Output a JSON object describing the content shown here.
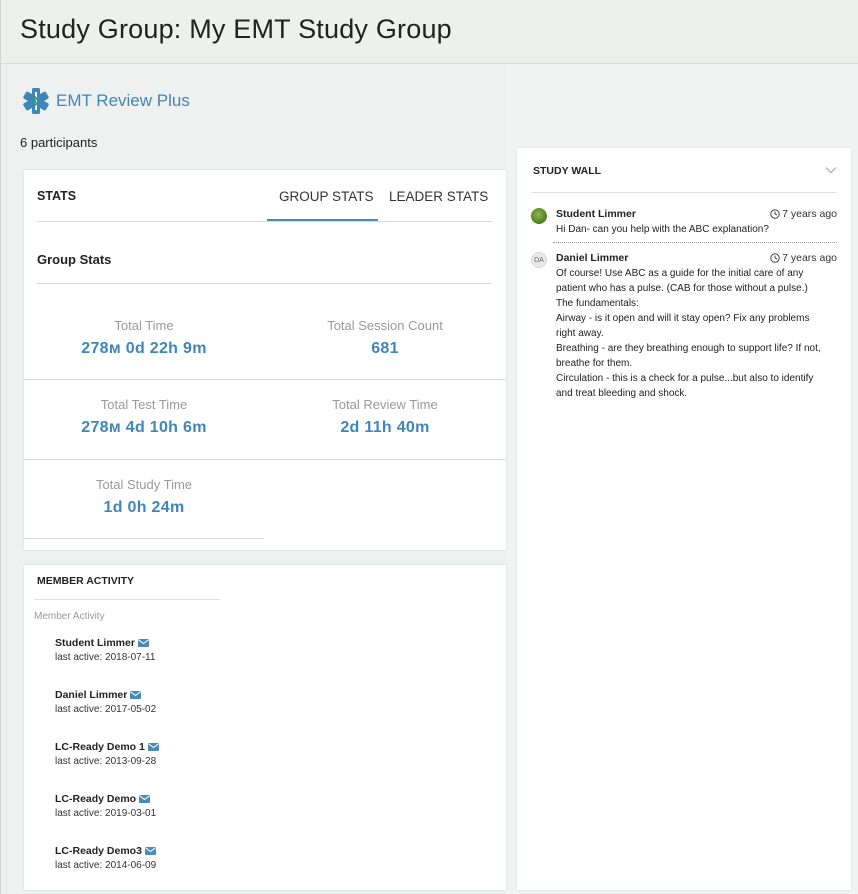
{
  "page": {
    "title": "Study Group: My EMT Study Group"
  },
  "course": {
    "name": "EMT Review Plus",
    "participants": "6 participants",
    "logo_icon": "star-of-life-icon",
    "logo_colors": {
      "primary": "#3f86b9",
      "accent": "#2e9a5c"
    }
  },
  "stats": {
    "heading": "STATS",
    "tabs": [
      "GROUP STATS",
      "LEADER STATS"
    ],
    "active_tab": "GROUP STATS",
    "group_title": "Group Stats",
    "items": [
      {
        "label": "Total Time",
        "value": "278м 0d 22h 9m"
      },
      {
        "label": "Total Session Count",
        "value": "681"
      },
      {
        "label": "Total Test Time",
        "value": "278м 4d 10h 6m"
      },
      {
        "label": "Total Review Time",
        "value": "2d 11h 40m"
      },
      {
        "label": "Total Study Time",
        "value": "1d 0h 24m"
      }
    ]
  },
  "member_activity": {
    "heading": "MEMBER ACTIVITY",
    "subheading": "Member Activity",
    "members": [
      {
        "name": "Student Limmer",
        "last_active": "last active: 2018-07-11"
      },
      {
        "name": "Daniel Limmer",
        "last_active": "last active: 2017-05-02"
      },
      {
        "name": "LC-Ready Demo 1",
        "last_active": "last active: 2013-09-28"
      },
      {
        "name": "LC-Ready Demo",
        "last_active": "last active: 2019-03-01"
      },
      {
        "name": "LC-Ready Demo3",
        "last_active": "last active: 2014-06-09"
      }
    ]
  },
  "study_wall": {
    "heading": "STUDY WALL",
    "posts": [
      {
        "author": "Student Limmer",
        "time": "7 years ago",
        "avatar": "photo",
        "lines": [
          "Hi Dan- can you help with the ABC explanation?"
        ]
      },
      {
        "author": "Daniel Limmer",
        "time": "7 years ago",
        "avatar": "DA",
        "lines": [
          "Of course! Use ABC as a guide for the initial care of any",
          "patient who has a pulse. (CAB for those without a pulse.)",
          "The fundamentals:",
          "Airway - is it open and will it stay open? Fix any problems",
          "right away.",
          "Breathing - are they breathing enough to support life? If not,",
          "breathe for them.",
          "Circulation - this is a check for a pulse...but also to identify",
          "and treat bleeding and shock."
        ]
      }
    ]
  }
}
